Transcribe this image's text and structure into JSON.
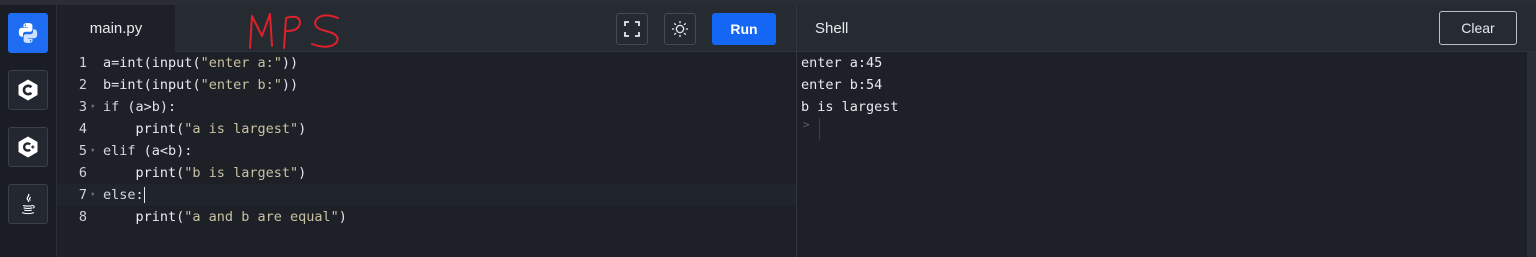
{
  "sidebar": {
    "languages": [
      {
        "name": "python",
        "icon": "python-icon",
        "active": true
      },
      {
        "name": "c",
        "icon": "c-icon",
        "active": false
      },
      {
        "name": "cpp",
        "icon": "cpp-icon",
        "active": false
      },
      {
        "name": "java",
        "icon": "java-icon",
        "active": false
      }
    ]
  },
  "editor": {
    "file_tab": "main.py",
    "run_label": "Run",
    "annotation": "MPS",
    "lines": [
      {
        "n": "1",
        "fold": "",
        "parts": [
          [
            "a=",
            ""
          ],
          [
            "int",
            "fn"
          ],
          [
            "(",
            ""
          ],
          [
            "input",
            "fn"
          ],
          [
            "(",
            ""
          ],
          [
            "\"enter a:\"",
            "str"
          ],
          [
            "))",
            ""
          ]
        ]
      },
      {
        "n": "2",
        "fold": "",
        "parts": [
          [
            "b=",
            ""
          ],
          [
            "int",
            "fn"
          ],
          [
            "(",
            ""
          ],
          [
            "input",
            "fn"
          ],
          [
            "(",
            ""
          ],
          [
            "\"enter b:\"",
            "str"
          ],
          [
            "))",
            ""
          ]
        ]
      },
      {
        "n": "3",
        "fold": "▾",
        "parts": [
          [
            "if",
            "kw"
          ],
          [
            " (a>b):",
            ""
          ]
        ]
      },
      {
        "n": "4",
        "fold": "",
        "parts": [
          [
            "    print",
            "fn"
          ],
          [
            "(",
            ""
          ],
          [
            "\"a is largest\"",
            "str"
          ],
          [
            ")",
            ""
          ]
        ]
      },
      {
        "n": "5",
        "fold": "▾",
        "parts": [
          [
            "elif",
            "kw"
          ],
          [
            " (a<b):",
            ""
          ]
        ]
      },
      {
        "n": "6",
        "fold": "",
        "parts": [
          [
            "    print",
            "fn"
          ],
          [
            "(",
            ""
          ],
          [
            "\"b is largest\"",
            "str"
          ],
          [
            ")",
            ""
          ]
        ]
      },
      {
        "n": "7",
        "fold": "▾",
        "parts": [
          [
            "else",
            "kw"
          ],
          [
            ":",
            ""
          ]
        ],
        "cursor": true
      },
      {
        "n": "8",
        "fold": "",
        "parts": [
          [
            "    print",
            "fn"
          ],
          [
            "(",
            ""
          ],
          [
            "\"a and b are equal\"",
            "str"
          ],
          [
            ")",
            ""
          ]
        ]
      }
    ]
  },
  "shell": {
    "title": "Shell",
    "clear_label": "Clear",
    "output": [
      "enter a:45",
      "enter b:54",
      "b is largest"
    ],
    "prompt": ">"
  },
  "colors": {
    "accent": "#1467f5",
    "background": "#1d2027",
    "annotation": "#e0202a"
  }
}
